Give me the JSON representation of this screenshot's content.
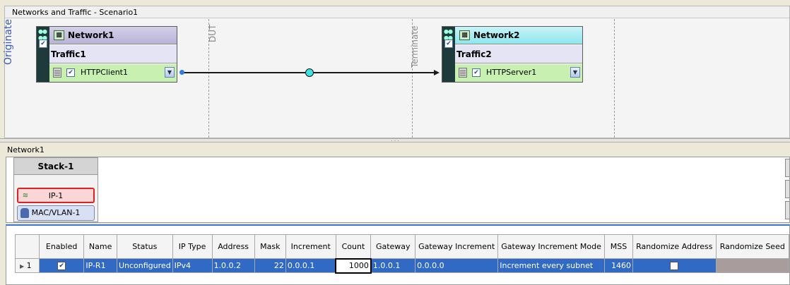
{
  "scenario": {
    "title": "Networks and Traffic - Scenario1",
    "originate_label": "Originate",
    "dut_label": "DUT",
    "terminate_label": "Terminate",
    "network1": {
      "name": "Network1",
      "traffic": "Traffic1",
      "agent": "HTTPClient1"
    },
    "network2": {
      "name": "Network2",
      "traffic": "Traffic2",
      "agent": "HTTPServer1"
    },
    "colors": {
      "network1_header": "#b9b4d8",
      "network2_header": "#8ee6ee",
      "agent_row": "#c8f0b0",
      "link_node": "#3fe0e0"
    }
  },
  "network_panel": {
    "title": "Network1",
    "stack": {
      "name": "Stack-1",
      "layers": [
        {
          "label": "IP-1",
          "selected": true
        },
        {
          "label": "MAC/VLAN-1",
          "selected": false
        }
      ]
    }
  },
  "grid": {
    "columns": [
      "",
      "Enabled",
      "Name",
      "Status",
      "IP Type",
      "Address",
      "Mask",
      "Increment",
      "Count",
      "Gateway",
      "Gateway Increment",
      "Gateway Increment Mode",
      "MSS",
      "Randomize Address",
      "Randomize Seed"
    ],
    "rows": [
      {
        "index": "1",
        "enabled": true,
        "name": "IP-R1",
        "status": "Unconfigured",
        "ip_type": "IPv4",
        "address": "1.0.0.2",
        "mask": "22",
        "increment": "0.0.0.1",
        "count": "1000",
        "gateway": "1.0.0.1",
        "gateway_increment": "0.0.0.0",
        "gateway_increment_mode": "Increment every subnet",
        "mss": "1460",
        "randomize_address": false,
        "randomize_seed": ""
      }
    ],
    "selection_color": "#316ac5"
  }
}
